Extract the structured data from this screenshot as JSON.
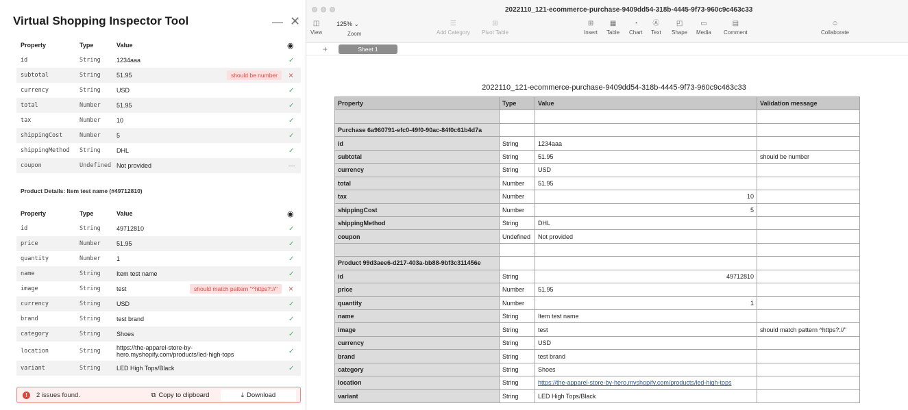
{
  "inspector": {
    "title": "Virtual Shopping Inspector Tool",
    "minimize_glyph": "—",
    "close_glyph": "✕",
    "columns": {
      "property": "Property",
      "type": "Type",
      "value": "Value"
    },
    "purchase_rows": [
      {
        "property": "id",
        "type": "String",
        "value": "1234aaa",
        "status": "ok"
      },
      {
        "property": "subtotal",
        "type": "String",
        "value": "51.95",
        "status": "error",
        "message": "should be number"
      },
      {
        "property": "currency",
        "type": "String",
        "value": "USD",
        "status": "ok"
      },
      {
        "property": "total",
        "type": "Number",
        "value": "51.95",
        "status": "ok"
      },
      {
        "property": "tax",
        "type": "Number",
        "value": "10",
        "status": "ok"
      },
      {
        "property": "shippingCost",
        "type": "Number",
        "value": "5",
        "status": "ok"
      },
      {
        "property": "shippingMethod",
        "type": "String",
        "value": "DHL",
        "status": "ok"
      },
      {
        "property": "coupon",
        "type": "Undefined",
        "value": "Not provided",
        "status": "none"
      }
    ],
    "product_title": "Product Details: Item test name (#49712810)",
    "product_rows": [
      {
        "property": "id",
        "type": "String",
        "value": "49712810",
        "status": "ok"
      },
      {
        "property": "price",
        "type": "Number",
        "value": "51.95",
        "status": "ok"
      },
      {
        "property": "quantity",
        "type": "Number",
        "value": "1",
        "status": "ok"
      },
      {
        "property": "name",
        "type": "String",
        "value": "Item test name",
        "status": "ok"
      },
      {
        "property": "image",
        "type": "String",
        "value": "test",
        "status": "error",
        "message": "should match pattern \"^https?://\""
      },
      {
        "property": "currency",
        "type": "String",
        "value": "USD",
        "status": "ok"
      },
      {
        "property": "brand",
        "type": "String",
        "value": "test brand",
        "status": "ok"
      },
      {
        "property": "category",
        "type": "String",
        "value": "Shoes",
        "status": "ok"
      },
      {
        "property": "location",
        "type": "String",
        "value": "https://the-apparel-store-by-hero.myshopify.com/products/led-high-tops",
        "status": "ok"
      },
      {
        "property": "variant",
        "type": "String",
        "value": "LED High Tops/Black",
        "status": "ok"
      }
    ],
    "footer": {
      "issues": "2 issues found.",
      "copy": "Copy to clipboard",
      "download": "Download"
    }
  },
  "numbers": {
    "window_title": "2022110_121-ecommerce-purchase-9409dd54-318b-4445-9f73-960c9c463c33",
    "toolbar": [
      {
        "label": "View",
        "icon": "sidebar-icon",
        "glyph": "◫",
        "enabled": true
      },
      {
        "label": "Zoom",
        "icon": "zoom-icon",
        "glyph": "",
        "enabled": true
      },
      {
        "label": "Add Category",
        "icon": "add-category-icon",
        "glyph": "☰",
        "enabled": false
      },
      {
        "label": "Pivot Table",
        "icon": "pivot-table-icon",
        "glyph": "⊞",
        "enabled": false
      },
      {
        "label": "Insert",
        "icon": "insert-icon",
        "glyph": "⊞",
        "enabled": true
      },
      {
        "label": "Table",
        "icon": "table-icon",
        "glyph": "▦",
        "enabled": true
      },
      {
        "label": "Chart",
        "icon": "chart-icon",
        "glyph": "◔",
        "enabled": true
      },
      {
        "label": "Text",
        "icon": "text-icon",
        "glyph": "Ⓐ",
        "enabled": true
      },
      {
        "label": "Shape",
        "icon": "shape-icon",
        "glyph": "◰",
        "enabled": true
      },
      {
        "label": "Media",
        "icon": "media-icon",
        "glyph": "▭",
        "enabled": true
      },
      {
        "label": "Comment",
        "icon": "comment-icon",
        "glyph": "▤",
        "enabled": true
      },
      {
        "label": "Collaborate",
        "icon": "collaborate-icon",
        "glyph": "☺",
        "enabled": true
      }
    ],
    "zoom_value": "125% ⌄",
    "sheet_tab": "Sheet 1",
    "sheet_title": "2022110_121-ecommerce-purchase-9409dd54-318b-4445-9f73-960c9c463c33",
    "columns": [
      "Property",
      "Type",
      "Value",
      "Validation message"
    ],
    "rows": [
      {
        "kind": "blank"
      },
      {
        "kind": "group",
        "label": "Purchase 6a960791-efc0-49f0-90ac-84f0c61b4d7a"
      },
      {
        "kind": "data",
        "property": "id",
        "type": "String",
        "value": "1234aaa",
        "align": "left",
        "message": ""
      },
      {
        "kind": "data",
        "property": "subtotal",
        "type": "String",
        "value": "51.95",
        "align": "left",
        "message": "should be number"
      },
      {
        "kind": "data",
        "property": "currency",
        "type": "String",
        "value": "USD",
        "align": "left",
        "message": ""
      },
      {
        "kind": "data",
        "property": "total",
        "type": "Number",
        "value": "51.95",
        "align": "left",
        "message": ""
      },
      {
        "kind": "data",
        "property": "tax",
        "type": "Number",
        "value": "10",
        "align": "right",
        "message": ""
      },
      {
        "kind": "data",
        "property": "shippingCost",
        "type": "Number",
        "value": "5",
        "align": "right",
        "message": ""
      },
      {
        "kind": "data",
        "property": "shippingMethod",
        "type": "String",
        "value": "DHL",
        "align": "left",
        "message": ""
      },
      {
        "kind": "data",
        "property": "coupon",
        "type": "Undefined",
        "value": "Not provided",
        "align": "left",
        "message": ""
      },
      {
        "kind": "blank"
      },
      {
        "kind": "group",
        "label": "Product 99d3aee6-d217-403a-bb88-9bf3c311456e"
      },
      {
        "kind": "data",
        "property": "id",
        "type": "String",
        "value": "49712810",
        "align": "right",
        "message": ""
      },
      {
        "kind": "data",
        "property": "price",
        "type": "Number",
        "value": "51.95",
        "align": "left",
        "message": ""
      },
      {
        "kind": "data",
        "property": "quantity",
        "type": "Number",
        "value": "1",
        "align": "right",
        "message": ""
      },
      {
        "kind": "data",
        "property": "name",
        "type": "String",
        "value": "Item test name",
        "align": "left",
        "message": ""
      },
      {
        "kind": "data",
        "property": "image",
        "type": "String",
        "value": "test",
        "align": "left",
        "message": "should match pattern ^https?://\""
      },
      {
        "kind": "data",
        "property": "currency",
        "type": "String",
        "value": "USD",
        "align": "left",
        "message": ""
      },
      {
        "kind": "data",
        "property": "brand",
        "type": "String",
        "value": "test brand",
        "align": "left",
        "message": ""
      },
      {
        "kind": "data",
        "property": "category",
        "type": "String",
        "value": "Shoes",
        "align": "left",
        "message": ""
      },
      {
        "kind": "data",
        "property": "location",
        "type": "String",
        "value": "https://the-apparel-store-by-hero.myshopify.com/products/led-high-tops",
        "align": "link",
        "message": ""
      },
      {
        "kind": "data",
        "property": "variant",
        "type": "String",
        "value": "LED High Tops/Black",
        "align": "left",
        "message": ""
      }
    ]
  },
  "colors": {
    "ok": "#4caf6a",
    "error": "#e0524c",
    "error_bg": "#fbe0df",
    "header_bg": "#c8c8c8",
    "prop_bg": "#dcdcdc"
  }
}
